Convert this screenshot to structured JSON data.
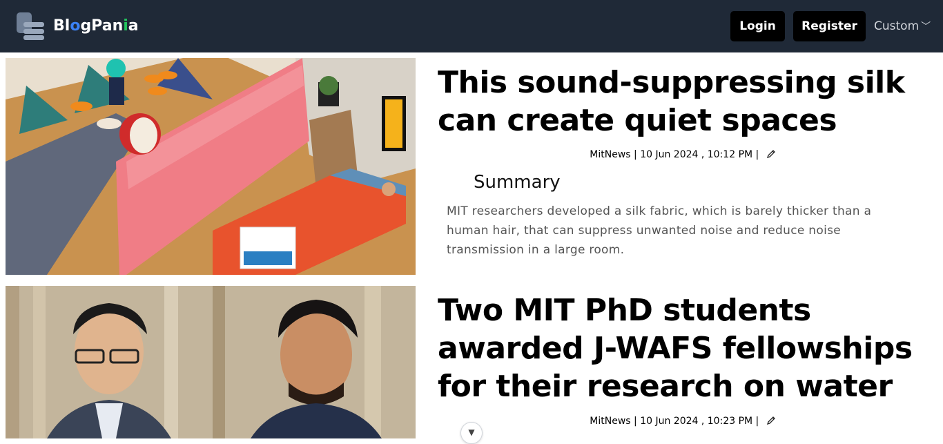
{
  "header": {
    "brand_parts": [
      "Bl",
      "o",
      "gPan",
      "i",
      "a"
    ],
    "login_label": "Login",
    "register_label": "Register",
    "custom_label": "Custom",
    "colors": {
      "topbar": "#1f2937",
      "button": "#000000"
    }
  },
  "articles": [
    {
      "title": "This sound-suppressing silk can create quiet spaces",
      "author": "MitNews",
      "date": "10 Jun 2024 , 10:12 PM",
      "summary_heading": "Summary",
      "summary": "MIT researchers developed a silk fabric, which is barely thicker than a human hair, that can suppress unwanted noise and reduce noise transmission in a large room.",
      "image_icon": "isometric-room-illustration"
    },
    {
      "title": "Two MIT PhD students awarded J-WAFS fellowships for their research on water",
      "author": "MitNews",
      "date": "10 Jun 2024 , 10:23 PM",
      "image_icon": "two-students-photo"
    }
  ],
  "icons": {
    "edit": "pencil-icon",
    "scroll": "chevron-down-icon",
    "custom_chevron": "chevron-down-icon"
  }
}
